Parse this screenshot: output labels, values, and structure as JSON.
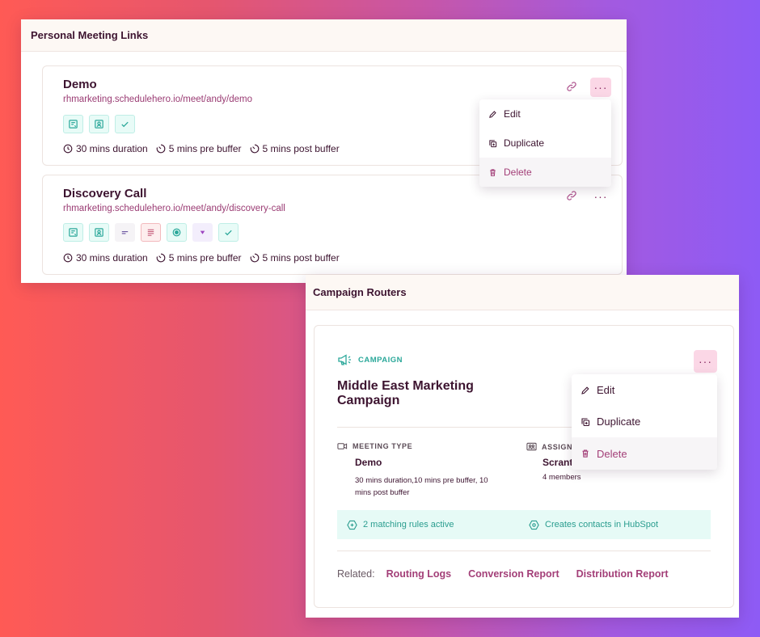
{
  "links_panel": {
    "title": "Personal Meeting Links",
    "cards": [
      {
        "title": "Demo",
        "url": "rhmarketing.schedulehero.io/meet/andy/demo",
        "duration": "30 mins duration",
        "pre_buffer": "5 mins pre buffer",
        "post_buffer": "5 mins post buffer"
      },
      {
        "title": "Discovery Call",
        "url": "rhmarketing.schedulehero.io/meet/andy/discovery-call",
        "duration": "30 mins duration",
        "pre_buffer": "5 mins pre buffer",
        "post_buffer": "5 mins post buffer"
      }
    ],
    "menu": {
      "edit": "Edit",
      "duplicate": "Duplicate",
      "delete": "Delete"
    }
  },
  "campaign_panel": {
    "title": "Campaign Routers",
    "tag": "CAMPAIGN",
    "campaign_title": "Middle East Marketing Campaign",
    "meeting_type_label": "MEETING TYPE",
    "meeting_type_value": "Demo",
    "meeting_type_sub": "30 mins duration,10 mins pre buffer, 10 mins post buffer",
    "assign_label": "ASSIGN",
    "assign_value": "Scrant",
    "assign_sub": "4 members",
    "rules": "2 matching rules active",
    "contacts": "Creates contacts in HubSpot",
    "related_label": "Related:",
    "related_links": [
      "Routing Logs",
      "Conversion Report",
      "Distribution Report"
    ],
    "menu": {
      "edit": "Edit",
      "duplicate": "Duplicate",
      "delete": "Delete"
    }
  },
  "more_glyph": "···",
  "colors": {
    "accent": "#a33f78",
    "teal": "#2ba89a",
    "title": "#3d1430"
  }
}
